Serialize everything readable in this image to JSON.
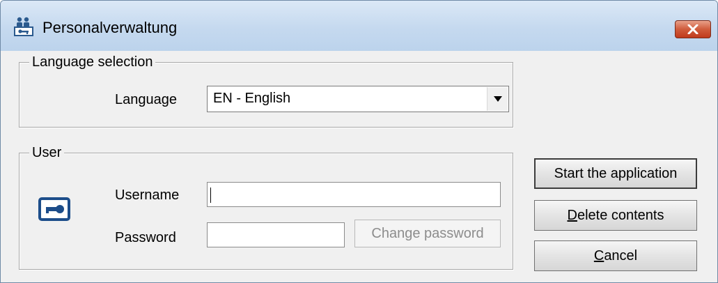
{
  "window": {
    "title": "Personalverwaltung",
    "app_icon": "people-key-icon",
    "close_icon": "close-x-icon"
  },
  "language_group": {
    "legend": "Language selection",
    "language_label": "Language",
    "language_value": "EN - English"
  },
  "user_group": {
    "legend": "User",
    "icon": "key-card-icon",
    "username_label": "Username",
    "username_value": "",
    "password_label": "Password",
    "password_value": "",
    "change_password_label": "Change password"
  },
  "buttons": {
    "start_label": "Start the application",
    "delete_mnemonic": "D",
    "delete_rest": "elete contents",
    "cancel_mnemonic": "C",
    "cancel_rest": "ancel"
  },
  "colors": {
    "titlebar": "#c5d9ef",
    "close_button": "#c84a2c",
    "dialog_background": "#f0f0f0",
    "key_icon": "#1c4d8a"
  }
}
